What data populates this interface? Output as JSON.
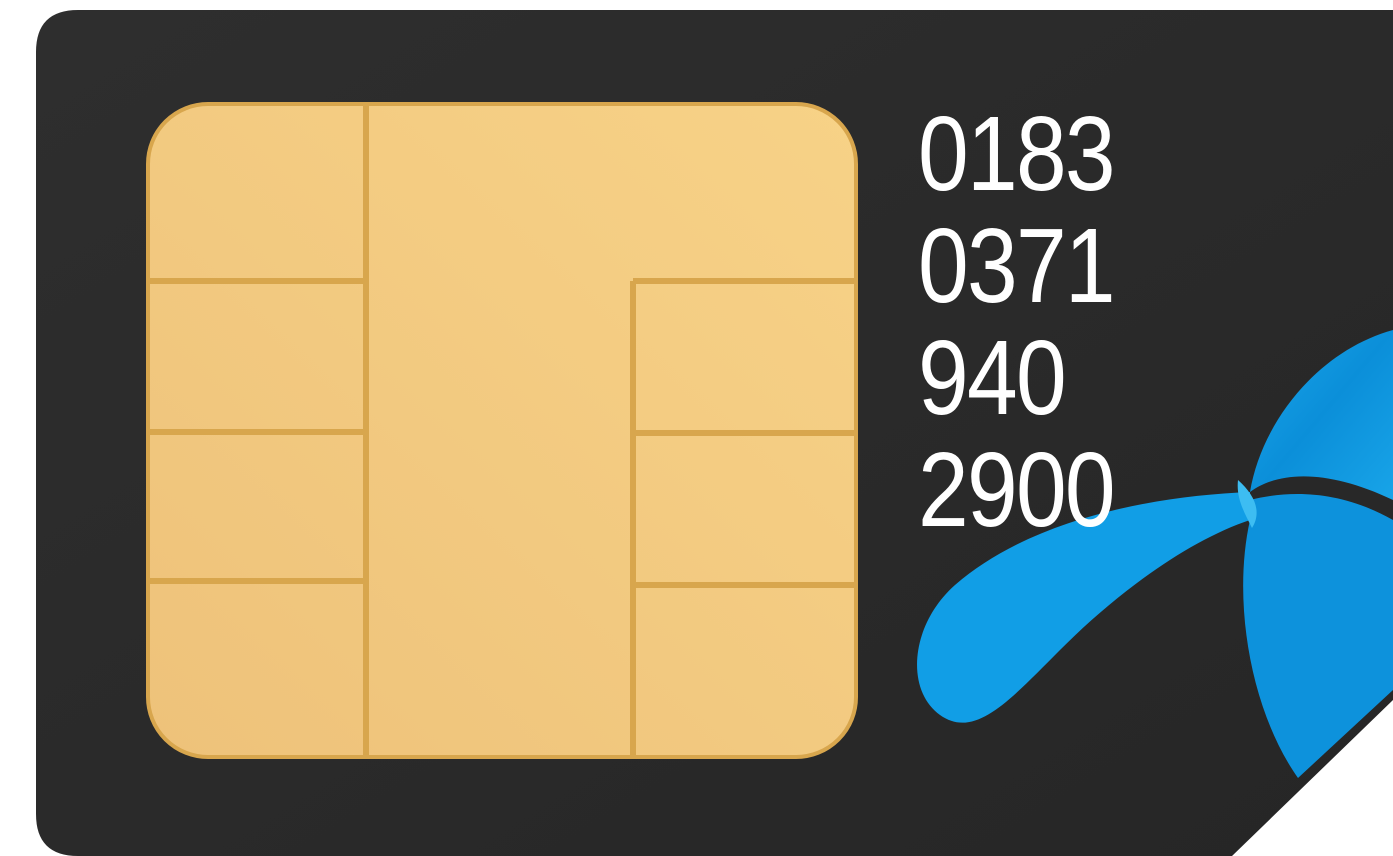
{
  "sim_card": {
    "number_lines": [
      "0183",
      "0371",
      "940",
      "2900"
    ],
    "card_color": "#2b2b2b",
    "chip_color": "#f2c97d",
    "chip_line_color": "#d8a64d",
    "logo_color": "#00a9e8",
    "logo_icon": "telenor-propeller-logo-icon"
  }
}
